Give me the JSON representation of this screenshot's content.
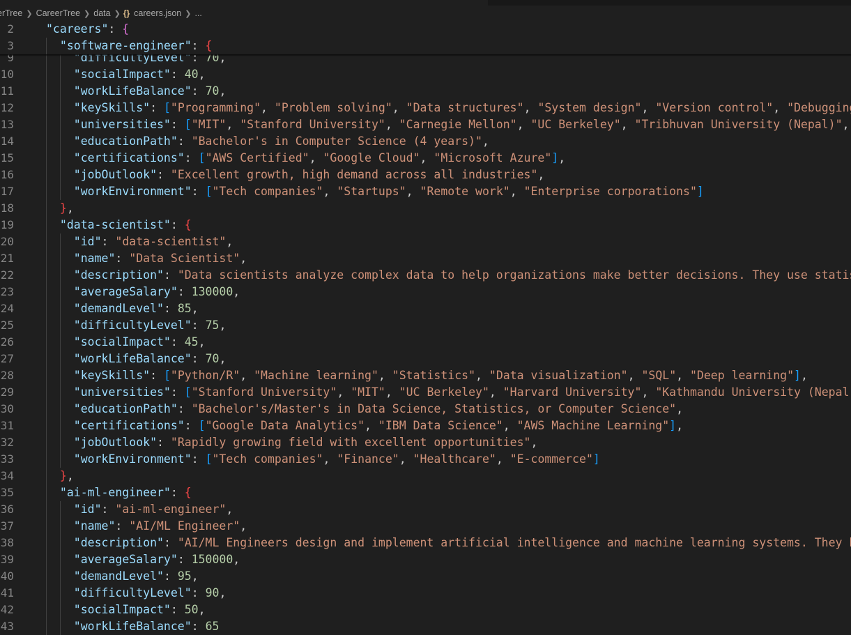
{
  "breadcrumb": {
    "items": [
      "erTree",
      "CareerTree",
      "data"
    ],
    "file_icon": "{}",
    "file": "careers.json",
    "more": "..."
  },
  "icons": {
    "chevron": "chevron-right-icon",
    "json": "json-file-icon"
  },
  "colors": {
    "background": "#1f1f1f",
    "key": "#9cdcfe",
    "string": "#ce9178",
    "number": "#b5cea8",
    "line_number": "#858585"
  },
  "sticky_lines": [
    {
      "n": "2",
      "indent": 0,
      "segs": [
        [
          "k",
          "\"careers\""
        ],
        [
          "p",
          ": "
        ],
        [
          "b2",
          "{"
        ]
      ]
    },
    {
      "n": "3",
      "indent": 1,
      "segs": [
        [
          "k",
          "\"software-engineer\""
        ],
        [
          "p",
          ": "
        ],
        [
          "b2r",
          "{"
        ]
      ]
    }
  ],
  "lines": [
    {
      "n": "9",
      "indent": 2,
      "segs": [
        [
          "k",
          "\"difficultyLevel\""
        ],
        [
          "p",
          ": "
        ],
        [
          "n",
          "70"
        ],
        [
          "p",
          ","
        ]
      ]
    },
    {
      "n": "10",
      "indent": 2,
      "segs": [
        [
          "k",
          "\"socialImpact\""
        ],
        [
          "p",
          ": "
        ],
        [
          "n",
          "40"
        ],
        [
          "p",
          ","
        ]
      ]
    },
    {
      "n": "11",
      "indent": 2,
      "segs": [
        [
          "k",
          "\"workLifeBalance\""
        ],
        [
          "p",
          ": "
        ],
        [
          "n",
          "70"
        ],
        [
          "p",
          ","
        ]
      ]
    },
    {
      "n": "12",
      "indent": 2,
      "segs": [
        [
          "k",
          "\"keySkills\""
        ],
        [
          "p",
          ": "
        ],
        [
          "b3",
          "["
        ],
        [
          "s",
          "\"Programming\""
        ],
        [
          "p",
          ", "
        ],
        [
          "s",
          "\"Problem solving\""
        ],
        [
          "p",
          ", "
        ],
        [
          "s",
          "\"Data structures\""
        ],
        [
          "p",
          ", "
        ],
        [
          "s",
          "\"System design\""
        ],
        [
          "p",
          ", "
        ],
        [
          "s",
          "\"Version control\""
        ],
        [
          "p",
          ", "
        ],
        [
          "s",
          "\"Debugging"
        ]
      ]
    },
    {
      "n": "13",
      "indent": 2,
      "segs": [
        [
          "k",
          "\"universities\""
        ],
        [
          "p",
          ": "
        ],
        [
          "b3",
          "["
        ],
        [
          "s",
          "\"MIT\""
        ],
        [
          "p",
          ", "
        ],
        [
          "s",
          "\"Stanford University\""
        ],
        [
          "p",
          ", "
        ],
        [
          "s",
          "\"Carnegie Mellon\""
        ],
        [
          "p",
          ", "
        ],
        [
          "s",
          "\"UC Berkeley\""
        ],
        [
          "p",
          ", "
        ],
        [
          "s",
          "\"Tribhuvan University (Nepal)\""
        ],
        [
          "p",
          ","
        ]
      ]
    },
    {
      "n": "14",
      "indent": 2,
      "segs": [
        [
          "k",
          "\"educationPath\""
        ],
        [
          "p",
          ": "
        ],
        [
          "s",
          "\"Bachelor's in Computer Science (4 years)\""
        ],
        [
          "p",
          ","
        ]
      ]
    },
    {
      "n": "15",
      "indent": 2,
      "segs": [
        [
          "k",
          "\"certifications\""
        ],
        [
          "p",
          ": "
        ],
        [
          "b3",
          "["
        ],
        [
          "s",
          "\"AWS Certified\""
        ],
        [
          "p",
          ", "
        ],
        [
          "s",
          "\"Google Cloud\""
        ],
        [
          "p",
          ", "
        ],
        [
          "s",
          "\"Microsoft Azure\""
        ],
        [
          "b3",
          "]"
        ],
        [
          "p",
          ","
        ]
      ]
    },
    {
      "n": "16",
      "indent": 2,
      "segs": [
        [
          "k",
          "\"jobOutlook\""
        ],
        [
          "p",
          ": "
        ],
        [
          "s",
          "\"Excellent growth, high demand across all industries\""
        ],
        [
          "p",
          ","
        ]
      ]
    },
    {
      "n": "17",
      "indent": 2,
      "segs": [
        [
          "k",
          "\"workEnvironment\""
        ],
        [
          "p",
          ": "
        ],
        [
          "b3",
          "["
        ],
        [
          "s",
          "\"Tech companies\""
        ],
        [
          "p",
          ", "
        ],
        [
          "s",
          "\"Startups\""
        ],
        [
          "p",
          ", "
        ],
        [
          "s",
          "\"Remote work\""
        ],
        [
          "p",
          ", "
        ],
        [
          "s",
          "\"Enterprise corporations\""
        ],
        [
          "b3",
          "]"
        ]
      ]
    },
    {
      "n": "18",
      "indent": 1,
      "segs": [
        [
          "b2r",
          "}"
        ],
        [
          "p",
          ","
        ]
      ]
    },
    {
      "n": "19",
      "indent": 1,
      "segs": [
        [
          "k",
          "\"data-scientist\""
        ],
        [
          "p",
          ": "
        ],
        [
          "b2r",
          "{"
        ]
      ]
    },
    {
      "n": "20",
      "indent": 2,
      "segs": [
        [
          "k",
          "\"id\""
        ],
        [
          "p",
          ": "
        ],
        [
          "s",
          "\"data-scientist\""
        ],
        [
          "p",
          ","
        ]
      ]
    },
    {
      "n": "21",
      "indent": 2,
      "segs": [
        [
          "k",
          "\"name\""
        ],
        [
          "p",
          ": "
        ],
        [
          "s",
          "\"Data Scientist\""
        ],
        [
          "p",
          ","
        ]
      ]
    },
    {
      "n": "22",
      "indent": 2,
      "segs": [
        [
          "k",
          "\"description\""
        ],
        [
          "p",
          ": "
        ],
        [
          "s",
          "\"Data scientists analyze complex data to help organizations make better decisions. They use statis"
        ]
      ]
    },
    {
      "n": "23",
      "indent": 2,
      "segs": [
        [
          "k",
          "\"averageSalary\""
        ],
        [
          "p",
          ": "
        ],
        [
          "n",
          "130000"
        ],
        [
          "p",
          ","
        ]
      ]
    },
    {
      "n": "24",
      "indent": 2,
      "segs": [
        [
          "k",
          "\"demandLevel\""
        ],
        [
          "p",
          ": "
        ],
        [
          "n",
          "85"
        ],
        [
          "p",
          ","
        ]
      ]
    },
    {
      "n": "25",
      "indent": 2,
      "segs": [
        [
          "k",
          "\"difficultyLevel\""
        ],
        [
          "p",
          ": "
        ],
        [
          "n",
          "75"
        ],
        [
          "p",
          ","
        ]
      ]
    },
    {
      "n": "26",
      "indent": 2,
      "segs": [
        [
          "k",
          "\"socialImpact\""
        ],
        [
          "p",
          ": "
        ],
        [
          "n",
          "45"
        ],
        [
          "p",
          ","
        ]
      ]
    },
    {
      "n": "27",
      "indent": 2,
      "segs": [
        [
          "k",
          "\"workLifeBalance\""
        ],
        [
          "p",
          ": "
        ],
        [
          "n",
          "70"
        ],
        [
          "p",
          ","
        ]
      ]
    },
    {
      "n": "28",
      "indent": 2,
      "segs": [
        [
          "k",
          "\"keySkills\""
        ],
        [
          "p",
          ": "
        ],
        [
          "b3",
          "["
        ],
        [
          "s",
          "\"Python/R\""
        ],
        [
          "p",
          ", "
        ],
        [
          "s",
          "\"Machine learning\""
        ],
        [
          "p",
          ", "
        ],
        [
          "s",
          "\"Statistics\""
        ],
        [
          "p",
          ", "
        ],
        [
          "s",
          "\"Data visualization\""
        ],
        [
          "p",
          ", "
        ],
        [
          "s",
          "\"SQL\""
        ],
        [
          "p",
          ", "
        ],
        [
          "s",
          "\"Deep learning\""
        ],
        [
          "b3",
          "]"
        ],
        [
          "p",
          ","
        ]
      ]
    },
    {
      "n": "29",
      "indent": 2,
      "segs": [
        [
          "k",
          "\"universities\""
        ],
        [
          "p",
          ": "
        ],
        [
          "b3",
          "["
        ],
        [
          "s",
          "\"Stanford University\""
        ],
        [
          "p",
          ", "
        ],
        [
          "s",
          "\"MIT\""
        ],
        [
          "p",
          ", "
        ],
        [
          "s",
          "\"UC Berkeley\""
        ],
        [
          "p",
          ", "
        ],
        [
          "s",
          "\"Harvard University\""
        ],
        [
          "p",
          ", "
        ],
        [
          "s",
          "\"Kathmandu University (Nepal)"
        ]
      ]
    },
    {
      "n": "30",
      "indent": 2,
      "segs": [
        [
          "k",
          "\"educationPath\""
        ],
        [
          "p",
          ": "
        ],
        [
          "s",
          "\"Bachelor's/Master's in Data Science, Statistics, or Computer Science\""
        ],
        [
          "p",
          ","
        ]
      ]
    },
    {
      "n": "31",
      "indent": 2,
      "segs": [
        [
          "k",
          "\"certifications\""
        ],
        [
          "p",
          ": "
        ],
        [
          "b3",
          "["
        ],
        [
          "s",
          "\"Google Data Analytics\""
        ],
        [
          "p",
          ", "
        ],
        [
          "s",
          "\"IBM Data Science\""
        ],
        [
          "p",
          ", "
        ],
        [
          "s",
          "\"AWS Machine Learning\""
        ],
        [
          "b3",
          "]"
        ],
        [
          "p",
          ","
        ]
      ]
    },
    {
      "n": "32",
      "indent": 2,
      "segs": [
        [
          "k",
          "\"jobOutlook\""
        ],
        [
          "p",
          ": "
        ],
        [
          "s",
          "\"Rapidly growing field with excellent opportunities\""
        ],
        [
          "p",
          ","
        ]
      ]
    },
    {
      "n": "33",
      "indent": 2,
      "segs": [
        [
          "k",
          "\"workEnvironment\""
        ],
        [
          "p",
          ": "
        ],
        [
          "b3",
          "["
        ],
        [
          "s",
          "\"Tech companies\""
        ],
        [
          "p",
          ", "
        ],
        [
          "s",
          "\"Finance\""
        ],
        [
          "p",
          ", "
        ],
        [
          "s",
          "\"Healthcare\""
        ],
        [
          "p",
          ", "
        ],
        [
          "s",
          "\"E-commerce\""
        ],
        [
          "b3",
          "]"
        ]
      ]
    },
    {
      "n": "34",
      "indent": 1,
      "segs": [
        [
          "b2r",
          "}"
        ],
        [
          "p",
          ","
        ]
      ]
    },
    {
      "n": "35",
      "indent": 1,
      "segs": [
        [
          "k",
          "\"ai-ml-engineer\""
        ],
        [
          "p",
          ": "
        ],
        [
          "b2r",
          "{"
        ]
      ]
    },
    {
      "n": "36",
      "indent": 2,
      "segs": [
        [
          "k",
          "\"id\""
        ],
        [
          "p",
          ": "
        ],
        [
          "s",
          "\"ai-ml-engineer\""
        ],
        [
          "p",
          ","
        ]
      ]
    },
    {
      "n": "37",
      "indent": 2,
      "segs": [
        [
          "k",
          "\"name\""
        ],
        [
          "p",
          ": "
        ],
        [
          "s",
          "\"AI/ML Engineer\""
        ],
        [
          "p",
          ","
        ]
      ]
    },
    {
      "n": "38",
      "indent": 2,
      "segs": [
        [
          "k",
          "\"description\""
        ],
        [
          "p",
          ": "
        ],
        [
          "s",
          "\"AI/ML Engineers design and implement artificial intelligence and machine learning systems. They b"
        ]
      ]
    },
    {
      "n": "39",
      "indent": 2,
      "segs": [
        [
          "k",
          "\"averageSalary\""
        ],
        [
          "p",
          ": "
        ],
        [
          "n",
          "150000"
        ],
        [
          "p",
          ","
        ]
      ]
    },
    {
      "n": "40",
      "indent": 2,
      "segs": [
        [
          "k",
          "\"demandLevel\""
        ],
        [
          "p",
          ": "
        ],
        [
          "n",
          "95"
        ],
        [
          "p",
          ","
        ]
      ]
    },
    {
      "n": "41",
      "indent": 2,
      "segs": [
        [
          "k",
          "\"difficultyLevel\""
        ],
        [
          "p",
          ": "
        ],
        [
          "n",
          "90"
        ],
        [
          "p",
          ","
        ]
      ]
    },
    {
      "n": "42",
      "indent": 2,
      "segs": [
        [
          "k",
          "\"socialImpact\""
        ],
        [
          "p",
          ": "
        ],
        [
          "n",
          "50"
        ],
        [
          "p",
          ","
        ]
      ]
    },
    {
      "n": "43",
      "indent": 2,
      "segs": [
        [
          "k",
          "\"workLifeBalance\""
        ],
        [
          "p",
          ": "
        ],
        [
          "n",
          "65"
        ]
      ]
    }
  ]
}
